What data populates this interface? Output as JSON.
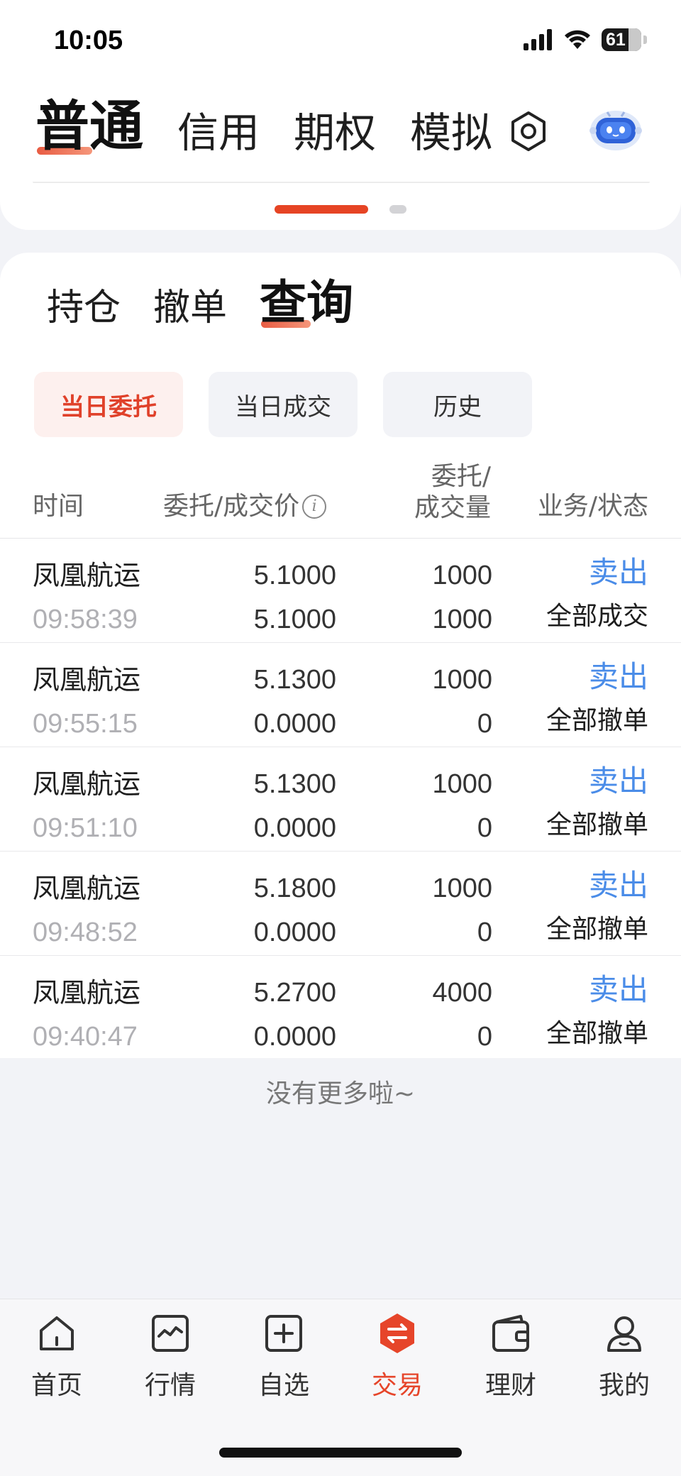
{
  "status_bar": {
    "time": "10:05",
    "battery": "61"
  },
  "account_tabs": [
    {
      "label": "普通",
      "active": true
    },
    {
      "label": "信用",
      "active": false
    },
    {
      "label": "期权",
      "active": false
    },
    {
      "label": "模拟",
      "active": false
    }
  ],
  "sub_tabs": [
    {
      "label": "持仓",
      "active": false
    },
    {
      "label": "撤单",
      "active": false
    },
    {
      "label": "查询",
      "active": true
    }
  ],
  "filters": [
    {
      "label": "当日委托",
      "active": true
    },
    {
      "label": "当日成交",
      "active": false
    },
    {
      "label": "历史",
      "active": false
    }
  ],
  "table": {
    "headers": {
      "time": "时间",
      "price": "委托/成交价",
      "qty_line1": "委托/",
      "qty_line2": "成交量",
      "status": "业务/状态"
    },
    "rows": [
      {
        "name": "凤凰航运",
        "time": "09:58:39",
        "order_price": "5.1000",
        "deal_price": "5.1000",
        "order_qty": "1000",
        "deal_qty": "1000",
        "side": "卖出",
        "state": "全部成交"
      },
      {
        "name": "凤凰航运",
        "time": "09:55:15",
        "order_price": "5.1300",
        "deal_price": "0.0000",
        "order_qty": "1000",
        "deal_qty": "0",
        "side": "卖出",
        "state": "全部撤单"
      },
      {
        "name": "凤凰航运",
        "time": "09:51:10",
        "order_price": "5.1300",
        "deal_price": "0.0000",
        "order_qty": "1000",
        "deal_qty": "0",
        "side": "卖出",
        "state": "全部撤单"
      },
      {
        "name": "凤凰航运",
        "time": "09:48:52",
        "order_price": "5.1800",
        "deal_price": "0.0000",
        "order_qty": "1000",
        "deal_qty": "0",
        "side": "卖出",
        "state": "全部撤单"
      },
      {
        "name": "凤凰航运",
        "time": "09:40:47",
        "order_price": "5.2700",
        "deal_price": "0.0000",
        "order_qty": "4000",
        "deal_qty": "0",
        "side": "卖出",
        "state": "全部撤单"
      }
    ]
  },
  "end_text": "没有更多啦~",
  "bottom_nav": [
    {
      "label": "首页",
      "icon": "home-icon",
      "active": false
    },
    {
      "label": "行情",
      "icon": "chart-icon",
      "active": false
    },
    {
      "label": "自选",
      "icon": "add-icon",
      "active": false
    },
    {
      "label": "交易",
      "icon": "trade-icon",
      "active": true
    },
    {
      "label": "理财",
      "icon": "wallet-icon",
      "active": false
    },
    {
      "label": "我的",
      "icon": "profile-icon",
      "active": false
    }
  ],
  "colors": {
    "accent": "#e6452a",
    "link": "#4a8ce8",
    "muted": "#b0b0b4"
  }
}
